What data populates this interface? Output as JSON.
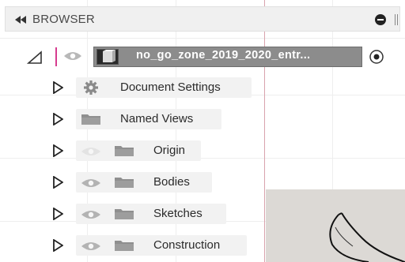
{
  "panel": {
    "title": "BROWSER"
  },
  "tree": {
    "root": {
      "label": "no_go_zone_2019_2020_entr..."
    },
    "items": [
      {
        "label": "Document Settings",
        "icon": "gear-icon"
      },
      {
        "label": "Named Views",
        "icon": "folder-icon"
      },
      {
        "label": "Origin",
        "icon": "folder-icon",
        "visibility": "hidden"
      },
      {
        "label": "Bodies",
        "icon": "folder-icon",
        "visibility": "visible"
      },
      {
        "label": "Sketches",
        "icon": "folder-icon",
        "visibility": "visible"
      },
      {
        "label": "Construction",
        "icon": "folder-icon",
        "visibility": "visible"
      }
    ]
  },
  "colors": {
    "active_bar": "#d63c8f",
    "selection": "#8c8c8c",
    "header_bg": "#f0f0f0"
  }
}
